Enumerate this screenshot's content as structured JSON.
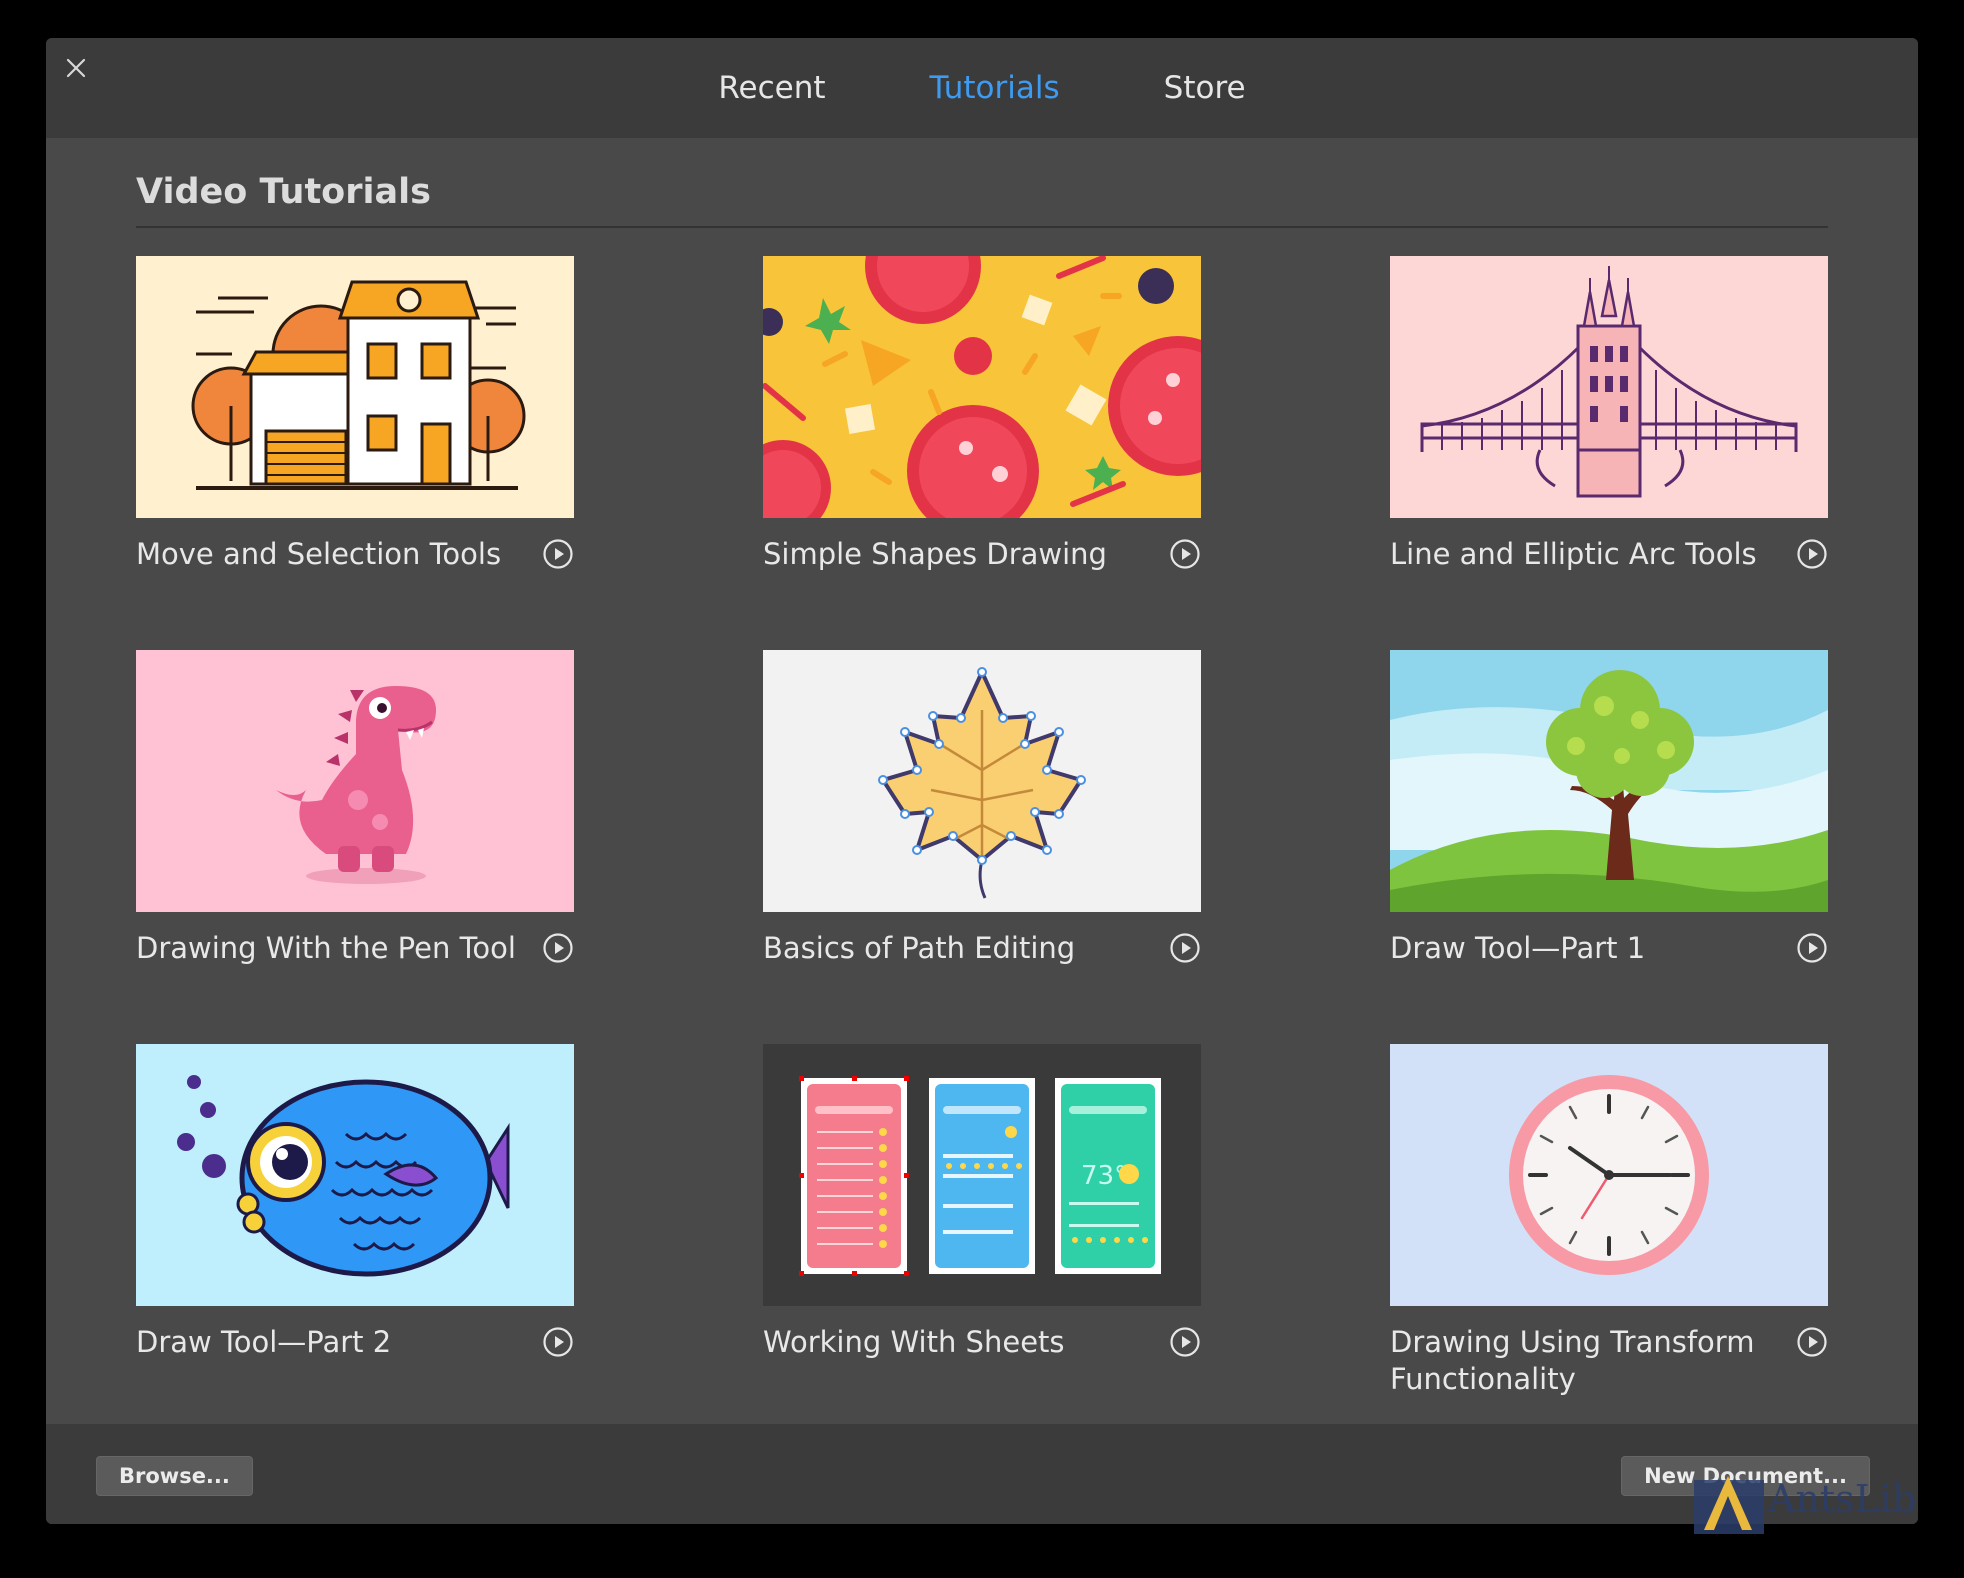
{
  "tabs": [
    {
      "label": "Recent",
      "active": false
    },
    {
      "label": "Tutorials",
      "active": true
    },
    {
      "label": "Store",
      "active": false
    }
  ],
  "section_title": "Video Tutorials",
  "tutorials": [
    {
      "title": "Move and Selection Tools",
      "thumb": "house-illustration"
    },
    {
      "title": "Simple Shapes Drawing",
      "thumb": "pizza-shapes-illustration"
    },
    {
      "title": "Line and Elliptic Arc Tools",
      "thumb": "bridge-illustration"
    },
    {
      "title": "Drawing With the Pen Tool",
      "thumb": "dinosaur-illustration"
    },
    {
      "title": "Basics of Path Editing",
      "thumb": "maple-leaf-illustration"
    },
    {
      "title": "Draw Tool—Part 1",
      "thumb": "tree-landscape-illustration"
    },
    {
      "title": "Draw Tool—Part 2",
      "thumb": "fish-illustration"
    },
    {
      "title": "Working With Sheets",
      "thumb": "weather-app-sheets-illustration"
    },
    {
      "title": "Drawing Using Transform Functionality",
      "thumb": "clock-illustration"
    }
  ],
  "footer": {
    "browse_label": "Browse...",
    "new_document_label": "New Document..."
  },
  "watermark": {
    "text": "AntsLib"
  },
  "colors": {
    "accent": "#3d9bf2",
    "window_bg": "#494949",
    "bar_bg": "#3b3b3b"
  }
}
